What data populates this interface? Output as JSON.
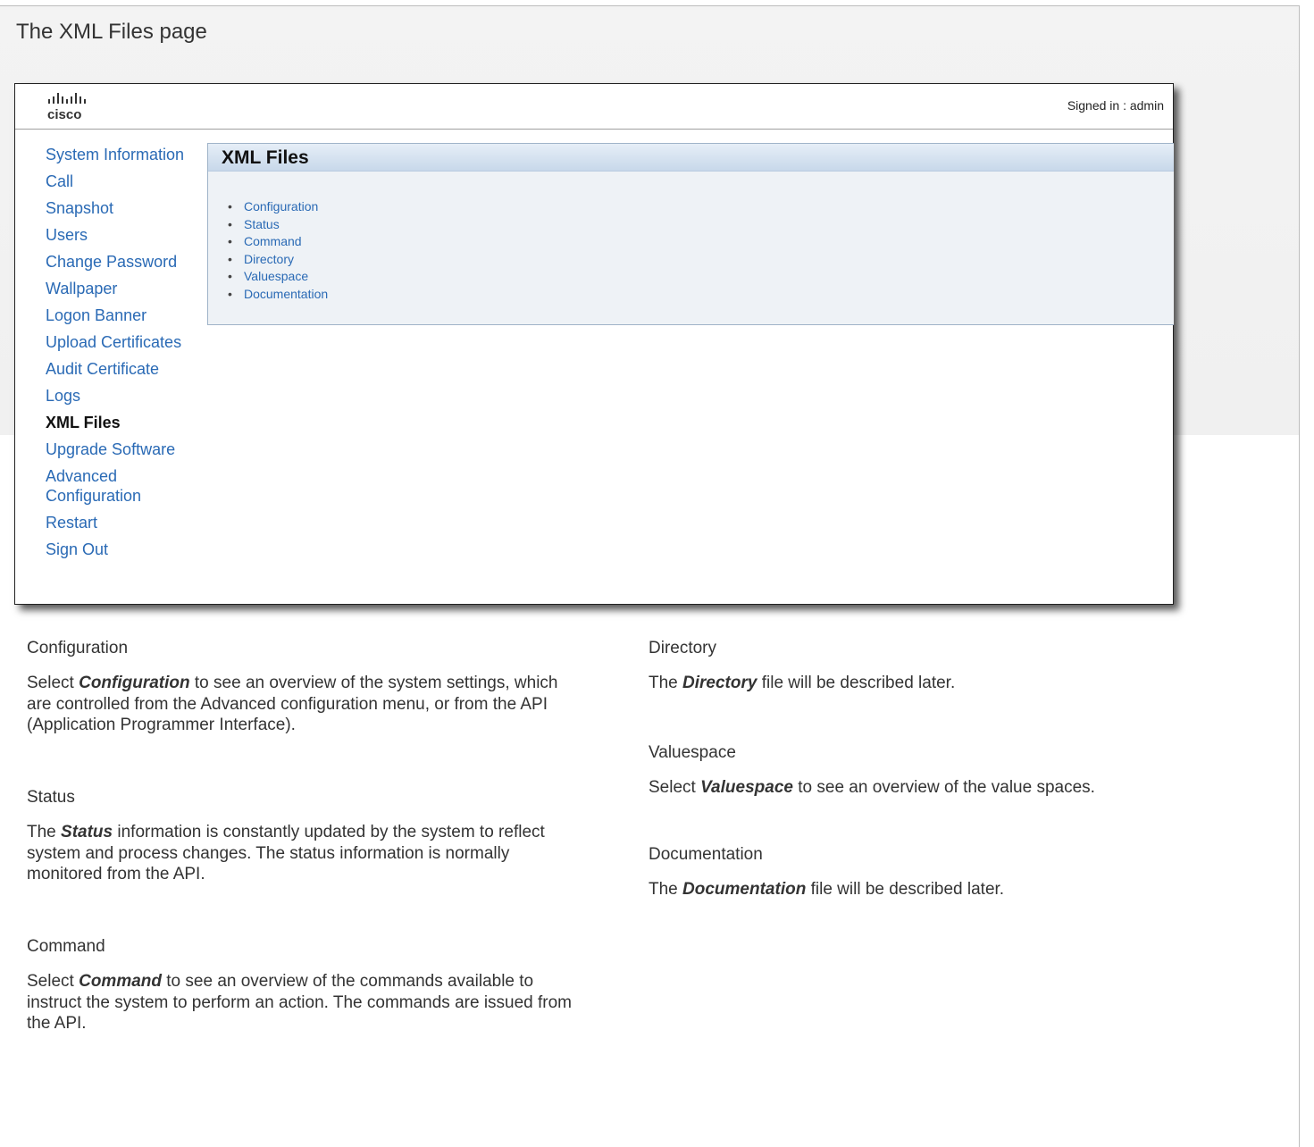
{
  "page_title": "The XML Files page",
  "window": {
    "logo_text": "cisco",
    "signed_in": "Signed in : admin",
    "nav": [
      {
        "label": "System Information",
        "active": false
      },
      {
        "label": "Call",
        "active": false
      },
      {
        "label": "Snapshot",
        "active": false
      },
      {
        "label": "Users",
        "active": false
      },
      {
        "label": "Change Password",
        "active": false
      },
      {
        "label": "Wallpaper",
        "active": false
      },
      {
        "label": "Logon Banner",
        "active": false
      },
      {
        "label": "Upload Certificates",
        "active": false
      },
      {
        "label": "Audit Certificate",
        "active": false
      },
      {
        "label": "Logs",
        "active": false
      },
      {
        "label": "XML Files",
        "active": true
      },
      {
        "label": "Upgrade Software",
        "active": false
      },
      {
        "label": "Advanced Configuration",
        "active": false
      },
      {
        "label": "Restart",
        "active": false
      },
      {
        "label": "Sign Out",
        "active": false
      }
    ],
    "panel_title": "XML Files",
    "links": [
      "Configuration",
      "Status",
      "Command",
      "Directory",
      "Valuespace",
      "Documentation"
    ]
  },
  "sections": {
    "configuration": {
      "heading": "Configuration",
      "pre": "Select ",
      "em": "Configuration",
      "post": " to see an overview of the system settings, which are controlled from the Advanced configuration menu, or from the API (Application Programmer Interface)."
    },
    "status": {
      "heading": "Status",
      "pre": "The ",
      "em": "Status",
      "post": " information is constantly updated by the system to reflect system and process changes. The status information is normally monitored from the API."
    },
    "command": {
      "heading": "Command",
      "pre": "Select ",
      "em": "Command",
      "post": " to see an overview of the commands available to instruct the system to perform an action. The commands are issued from the API."
    },
    "directory": {
      "heading": "Directory",
      "pre": "The ",
      "em": "Directory",
      "post": " file will be described later."
    },
    "valuespace": {
      "heading": "Valuespace",
      "pre": "Select ",
      "em": "Valuespace",
      "post": " to see an overview of the value spaces."
    },
    "documentation": {
      "heading": "Documentation",
      "pre": "The ",
      "em": "Documentation",
      "post": " file will be described later."
    }
  },
  "colors": {
    "link": "#2a6ab5",
    "panel_header": "#c8d8ea",
    "band": "#f0f0f0"
  }
}
